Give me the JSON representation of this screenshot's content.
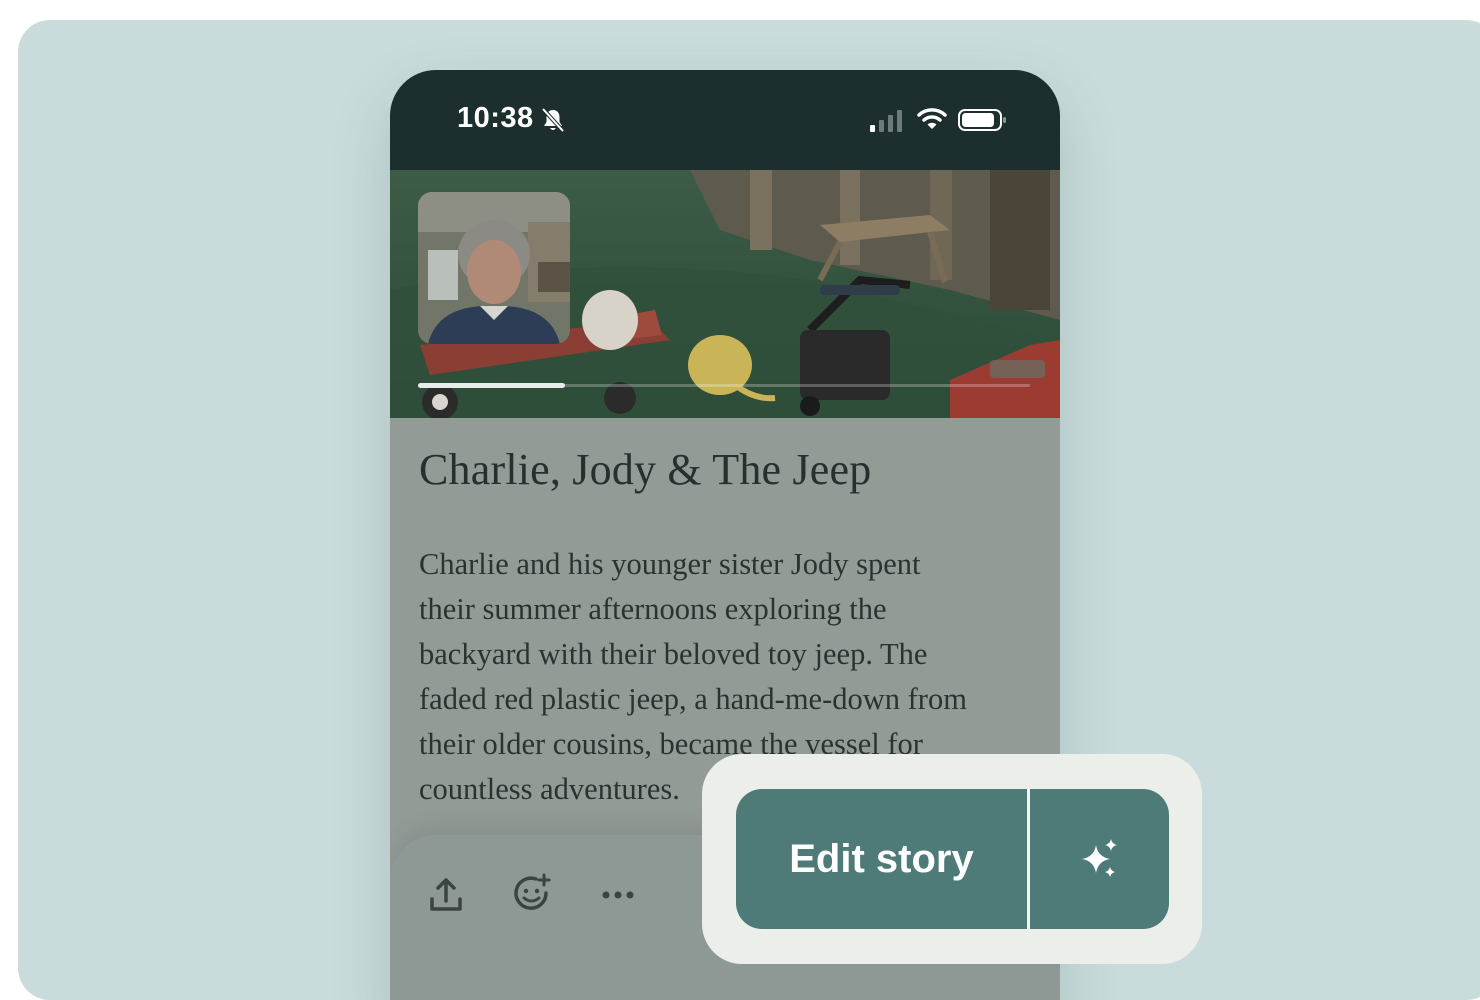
{
  "status_bar": {
    "time": "10:38",
    "icons": [
      "bell-slash-icon",
      "signal-icon",
      "wifi-icon",
      "battery-icon"
    ]
  },
  "video": {
    "progress": 0.24
  },
  "story": {
    "title": "Charlie, Jody & The Jeep",
    "body_lines": [
      "Charlie and his younger sister Jody spent",
      "their summer afternoons exploring the",
      "backyard with their beloved toy jeep. The",
      "faded red plastic jeep, a hand-me-down from",
      "their older cousins, became the vessel for",
      "countless adventures."
    ]
  },
  "actions": {
    "icons": [
      "share-icon",
      "add-reaction-icon",
      "more-icon"
    ]
  },
  "edit": {
    "label": "Edit story",
    "ai_icon": "sparkle-icon"
  },
  "colors": {
    "background": "#c9dcdb",
    "status_bar": "#1c2e2d",
    "accent": "#4e7b78",
    "highlight": "#ecefe9"
  }
}
